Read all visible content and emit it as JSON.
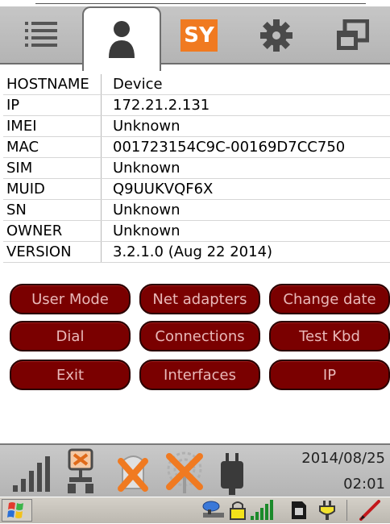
{
  "tabs": [
    {
      "icon": "list-icon"
    },
    {
      "icon": "user-icon",
      "active": true
    },
    {
      "icon": "sy-logo",
      "text": "SY",
      "color": "#f07a21"
    },
    {
      "icon": "gear-icon"
    },
    {
      "icon": "windows-icon"
    }
  ],
  "info": [
    {
      "key": "HOSTNAME",
      "value": "Device"
    },
    {
      "key": "IP",
      "value": "172.21.2.131"
    },
    {
      "key": "IMEI",
      "value": "Unknown"
    },
    {
      "key": "MAC",
      "value": "001723154C9C-00169D7CC750"
    },
    {
      "key": "SIM",
      "value": "Unknown"
    },
    {
      "key": "MUID",
      "value": "Q9UUKVQF6X"
    },
    {
      "key": "SN",
      "value": "Unknown"
    },
    {
      "key": "OWNER",
      "value": "Unknown"
    },
    {
      "key": "VERSION",
      "value": "3.2.1.0 (Aug 22 2014)"
    }
  ],
  "buttons": {
    "user_mode": "User Mode",
    "net_adapters": "Net adapters",
    "change_date": "Change date",
    "dial": "Dial",
    "connections": "Connections",
    "test_kbd": "Test Kbd",
    "exit": "Exit",
    "interfaces": "Interfaces",
    "ip": "IP"
  },
  "status": {
    "date": "2014/08/25",
    "time": "02:01"
  },
  "colors": {
    "button_bg": "#7a0000",
    "button_text": "#e9b9b9",
    "sy_orange": "#f07a21",
    "disabled_x": "#f07a21"
  }
}
